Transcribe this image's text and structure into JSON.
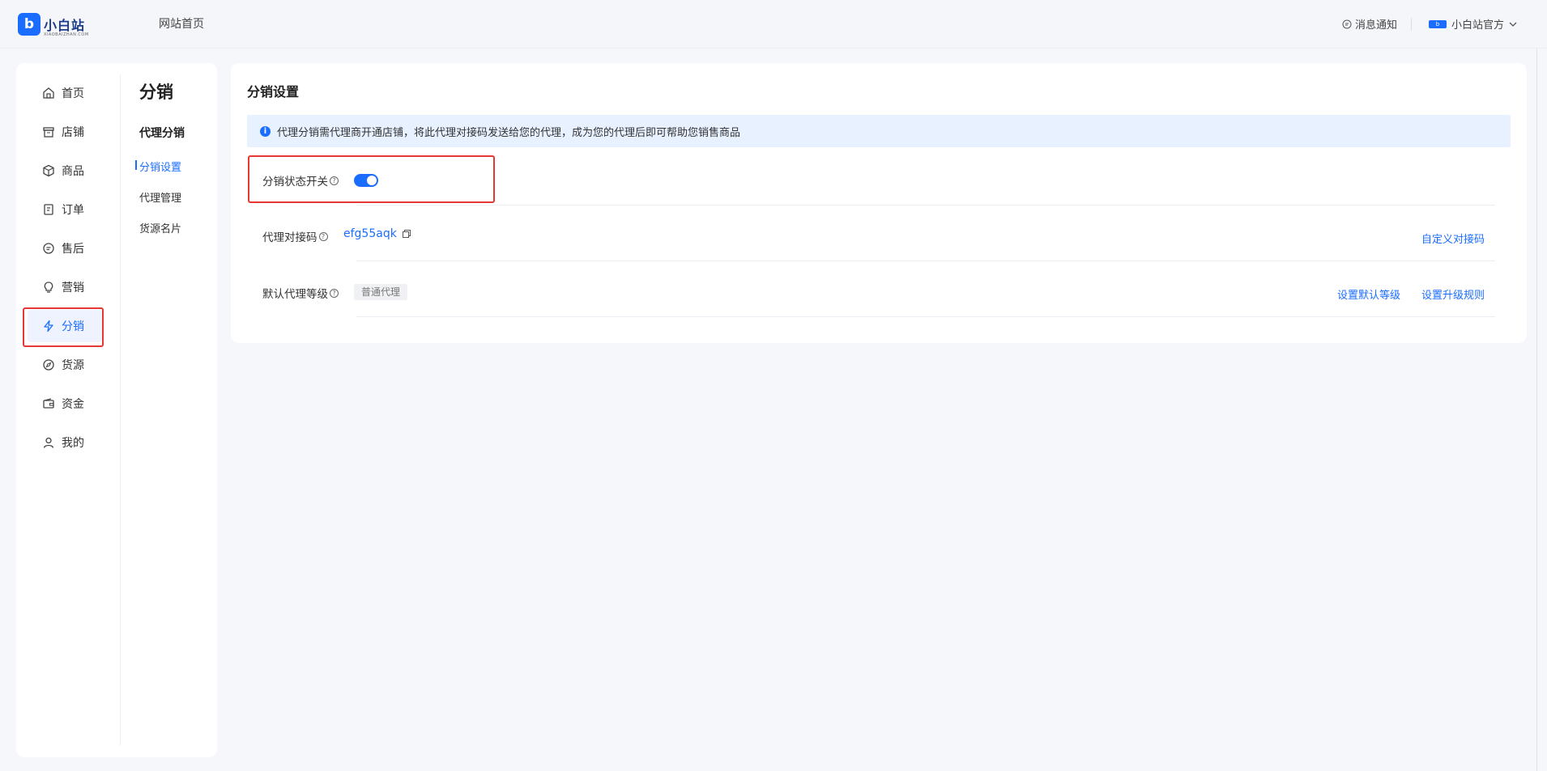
{
  "header": {
    "logo_text": "小白站",
    "logo_sub": "XIAOBAIZHAN.COM",
    "site_home": "网站首页",
    "notifications": "消息通知",
    "user_name": "小白站官方"
  },
  "nav": {
    "items": [
      {
        "label": "首页",
        "icon": "home-icon"
      },
      {
        "label": "店铺",
        "icon": "store-icon"
      },
      {
        "label": "商品",
        "icon": "box-icon"
      },
      {
        "label": "订单",
        "icon": "document-icon"
      },
      {
        "label": "售后",
        "icon": "chat-icon"
      },
      {
        "label": "营销",
        "icon": "lightbulb-icon"
      },
      {
        "label": "分销",
        "icon": "lightning-icon",
        "active": true
      },
      {
        "label": "货源",
        "icon": "compass-icon"
      },
      {
        "label": "资金",
        "icon": "wallet-icon"
      },
      {
        "label": "我的",
        "icon": "user-icon"
      }
    ]
  },
  "subnav": {
    "title": "分销",
    "group": "代理分销",
    "items": [
      "分销设置",
      "代理管理",
      "货源名片"
    ],
    "active_index": 0
  },
  "main": {
    "title": "分销设置",
    "notice": "代理分销需代理商开通店铺，将此代理对接码发送给您的代理，成为您的代理后即可帮助您销售商品",
    "status_label": "分销状态开关",
    "status_on": true,
    "code_label": "代理对接码",
    "code_value": "efg55aqk",
    "custom_code_link": "自定义对接码",
    "level_label": "默认代理等级",
    "level_value": "普通代理",
    "set_default_level_link": "设置默认等级",
    "set_upgrade_rules_link": "设置升级规则"
  },
  "colors": {
    "accent": "#1a6dff",
    "highlight": "#e53935",
    "notice_bg": "#e8f1ff"
  }
}
